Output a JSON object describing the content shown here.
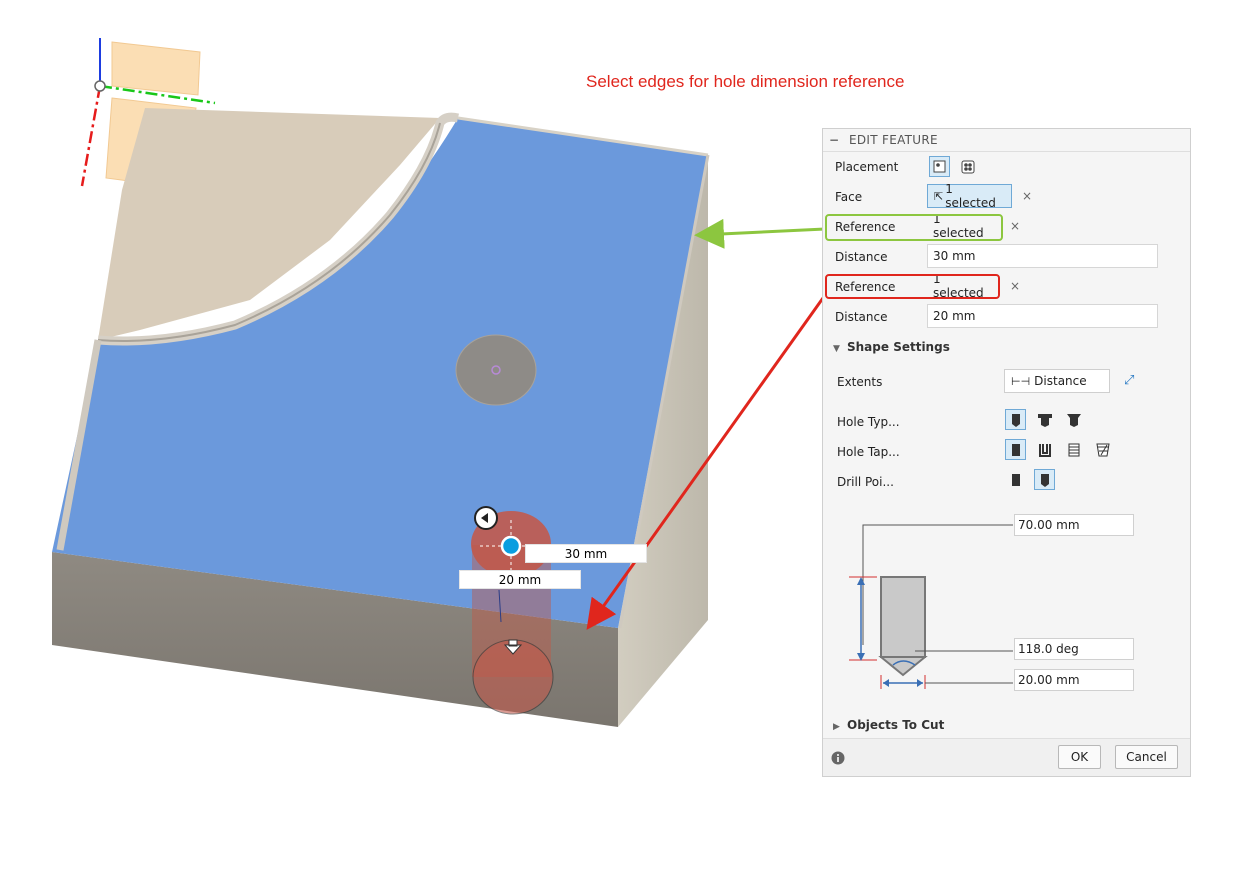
{
  "instruction": "Select edges for hole dimension reference",
  "viewport": {
    "dim_labels": {
      "distance_a": "30 mm",
      "distance_b": "20 mm"
    }
  },
  "panel": {
    "header": "EDIT FEATURE",
    "placement_label": "Placement",
    "face_label": "Face",
    "face_value": "1 selected",
    "reference1_label": "Reference",
    "reference1_value": "1 selected",
    "distance1_label": "Distance",
    "distance1_value": "30 mm",
    "reference2_label": "Reference",
    "reference2_value": "1 selected",
    "distance2_label": "Distance",
    "distance2_value": "20 mm",
    "shape_settings": "Shape Settings",
    "extents_label": "Extents",
    "extents_value": "Distance",
    "hole_type_label": "Hole Typ...",
    "hole_tap_label": "Hole Tap...",
    "drill_point_label": "Drill Poi...",
    "dims": {
      "depth": "70.00 mm",
      "angle": "118.0 deg",
      "diameter": "20.00 mm"
    },
    "objects_to_cut": "Objects To Cut",
    "ok": "OK",
    "cancel": "Cancel",
    "clear_symbol": "×"
  },
  "colors": {
    "face_blue": "#6b99dc",
    "highlight_green": "#8cc63f",
    "highlight_red": "#e0261d"
  }
}
